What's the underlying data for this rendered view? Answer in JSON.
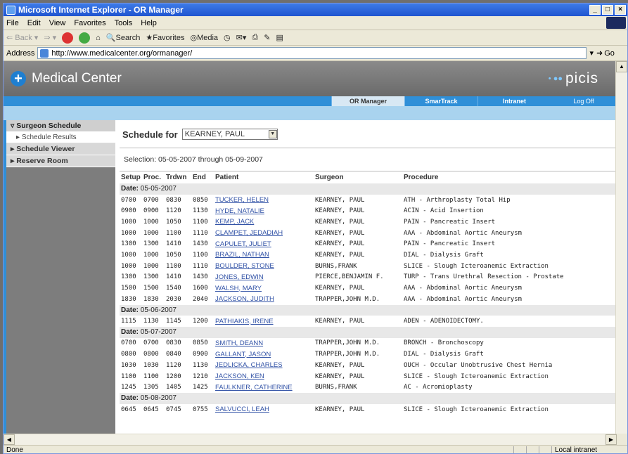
{
  "window": {
    "title": "Microsoft Internet Explorer - OR Manager"
  },
  "menubar": {
    "items": [
      "File",
      "Edit",
      "View",
      "Favorites",
      "Tools",
      "Help"
    ]
  },
  "toolbar": {
    "back": "Back",
    "search": "Search",
    "favorites": "Favorites",
    "media": "Media"
  },
  "address": {
    "label": "Address",
    "url": "http://www.medicalcenter.org/ormanager/",
    "go": "Go"
  },
  "banner": {
    "name": "Medical Center",
    "logo": "picis"
  },
  "nav": {
    "tabs": [
      "OR Manager",
      "SmarTrack",
      "Intranet"
    ],
    "logoff": "Log Off"
  },
  "sidebar": {
    "section1": "Surgeon Schedule",
    "section1_sub": "Schedule Results",
    "section2": "Schedule Viewer",
    "section3": "Reserve Room"
  },
  "main": {
    "schedule_label": "Schedule for",
    "surgeon_value": "KEARNEY, PAUL",
    "selection": "Selection:  05-05-2007 through 05-09-2007"
  },
  "table": {
    "headers": [
      "Setup",
      "Proc.",
      "Trdwn",
      "End",
      "Patient",
      "Surgeon",
      "Procedure"
    ],
    "date_label": "Date:"
  },
  "rows": [
    {
      "date": "05-05-2007"
    },
    {
      "setup": "0700",
      "proc": "0700",
      "trdwn": "0830",
      "end": "0850",
      "patient": "TUCKER, HELEN",
      "surgeon": "KEARNEY, PAUL",
      "procedure": "ATH - Arthroplasty Total Hip"
    },
    {
      "setup": "0900",
      "proc": "0900",
      "trdwn": "1120",
      "end": "1130",
      "patient": "HYDE, NATALIE",
      "surgeon": "KEARNEY, PAUL",
      "procedure": "ACIN - Acid Insertion"
    },
    {
      "setup": "1000",
      "proc": "1000",
      "trdwn": "1050",
      "end": "1100",
      "patient": "KEMP, JACK",
      "surgeon": "KEARNEY, PAUL",
      "procedure": "PAIN - Pancreatic Insert"
    },
    {
      "setup": "1000",
      "proc": "1000",
      "trdwn": "1100",
      "end": "1110",
      "patient": "CLAMPET, JEDADIAH",
      "surgeon": "KEARNEY, PAUL",
      "procedure": "AAA - Abdominal Aortic Aneurysm"
    },
    {
      "setup": "1300",
      "proc": "1300",
      "trdwn": "1410",
      "end": "1430",
      "patient": "CAPULET, JULIET",
      "surgeon": "KEARNEY, PAUL",
      "procedure": "PAIN - Pancreatic Insert"
    },
    {
      "setup": "1000",
      "proc": "1000",
      "trdwn": "1050",
      "end": "1100",
      "patient": "BRAZIL, NATHAN",
      "surgeon": "KEARNEY, PAUL",
      "procedure": "DIAL - Dialysis Graft"
    },
    {
      "setup": "1000",
      "proc": "1000",
      "trdwn": "1100",
      "end": "1110",
      "patient": "BOULDER, STONE",
      "surgeon": "BURNS,FRANK",
      "procedure": "SLICE - Slough Icteroanemic Extraction"
    },
    {
      "setup": "1300",
      "proc": "1300",
      "trdwn": "1410",
      "end": "1430",
      "patient": "JONES, EDWIN",
      "surgeon": "PIERCE,BENJAMIN F.",
      "procedure": "TURP - Trans Urethral Resection - Prostate"
    },
    {
      "setup": "1500",
      "proc": "1500",
      "trdwn": "1540",
      "end": "1600",
      "patient": "WALSH, MARY",
      "surgeon": "KEARNEY, PAUL",
      "procedure": "AAA - Abdominal Aortic Aneurysm"
    },
    {
      "setup": "1830",
      "proc": "1830",
      "trdwn": "2030",
      "end": "2040",
      "patient": "JACKSON, JUDITH",
      "surgeon": "TRAPPER,JOHN M.D.",
      "procedure": "AAA - Abdominal Aortic Aneurysm"
    },
    {
      "date": "05-06-2007"
    },
    {
      "setup": "1115",
      "proc": "1130",
      "trdwn": "1145",
      "end": "1200",
      "patient": "PATHIAKIS, IRENE",
      "surgeon": "KEARNEY, PAUL",
      "procedure": "ADEN - ADENOIDECTOMY."
    },
    {
      "date": "05-07-2007"
    },
    {
      "setup": "0700",
      "proc": "0700",
      "trdwn": "0830",
      "end": "0850",
      "patient": "SMITH, DEANN",
      "surgeon": "TRAPPER,JOHN M.D.",
      "procedure": "BRONCH - Bronchoscopy"
    },
    {
      "setup": "0800",
      "proc": "0800",
      "trdwn": "0840",
      "end": "0900",
      "patient": "GALLANT, JASON",
      "surgeon": "TRAPPER,JOHN M.D.",
      "procedure": "DIAL - Dialysis Graft"
    },
    {
      "setup": "1030",
      "proc": "1030",
      "trdwn": "1120",
      "end": "1130",
      "patient": "JEDLICKA, CHARLES",
      "surgeon": "KEARNEY, PAUL",
      "procedure": "OUCH - Occular Unobtrusive Chest Hernia"
    },
    {
      "setup": "1100",
      "proc": "1100",
      "trdwn": "1200",
      "end": "1210",
      "patient": "JACKSON, KEN",
      "surgeon": "KEARNEY, PAUL",
      "procedure": "SLICE - Slough Icteroanemic Extraction"
    },
    {
      "setup": "1245",
      "proc": "1305",
      "trdwn": "1405",
      "end": "1425",
      "patient": "FAULKNER, CATHERINE",
      "surgeon": "BURNS,FRANK",
      "procedure": "AC - Acromioplasty"
    },
    {
      "date": "05-08-2007"
    },
    {
      "setup": "0645",
      "proc": "0645",
      "trdwn": "0745",
      "end": "0755",
      "patient": "SALVUCCI, LEAH",
      "surgeon": "KEARNEY, PAUL",
      "procedure": "SLICE - Slough Icteroanemic Extraction"
    }
  ],
  "status": {
    "text": "Done",
    "zone": "Local intranet"
  }
}
